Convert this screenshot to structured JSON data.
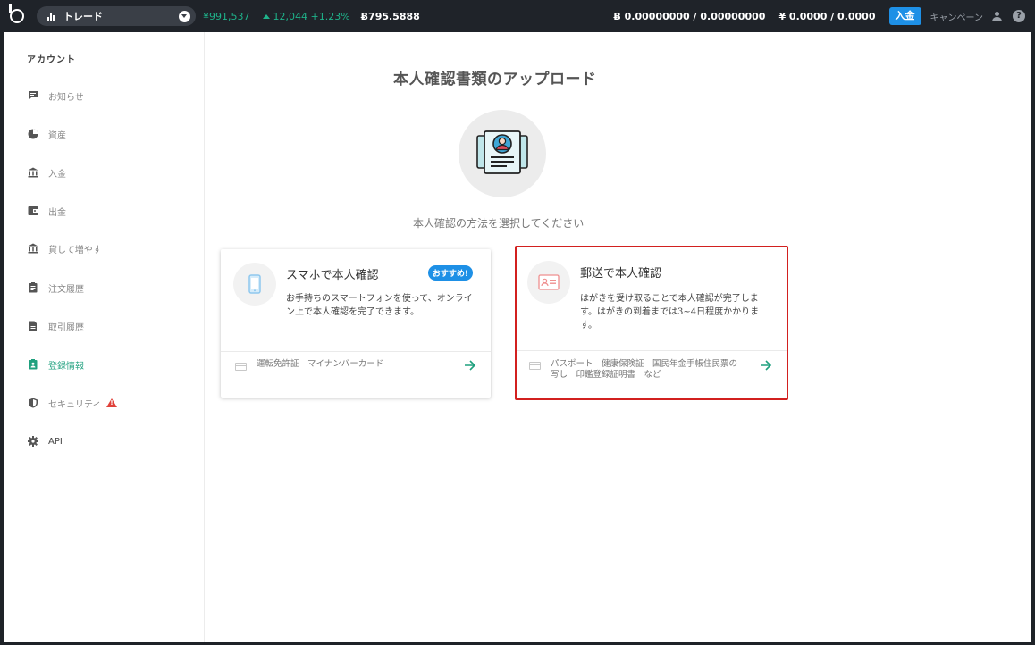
{
  "topbar": {
    "trade_label": "トレード",
    "price_jpy": "¥991,537",
    "change": "12,044 +1.23%",
    "btc_amount": "Ƀ795.5888",
    "btc_balance": "Ƀ 0.00000000 / 0.00000000",
    "jpy_balance": "¥ 0.0000 / 0.0000",
    "deposit_label": "入金",
    "campaign_label": "キャンペーン",
    "help_label": "?",
    "colors": {
      "bg": "#1f2329",
      "green": "#1fb28a",
      "accent": "#1e90e6"
    }
  },
  "sidebar": {
    "title": "アカウント",
    "items": [
      {
        "label": "お知らせ",
        "icon": "message-icon",
        "active": false
      },
      {
        "label": "資産",
        "icon": "pie-chart-icon",
        "active": false
      },
      {
        "label": "入金",
        "icon": "bank-icon",
        "active": false
      },
      {
        "label": "出金",
        "icon": "wallet-icon",
        "active": false
      },
      {
        "label": "貸して増やす",
        "icon": "bank-icon",
        "active": false
      },
      {
        "label": "注文履歴",
        "icon": "clipboard-icon",
        "active": false
      },
      {
        "label": "取引履歴",
        "icon": "document-icon",
        "active": false
      },
      {
        "label": "登録情報",
        "icon": "id-badge-icon",
        "active": true
      },
      {
        "label": "セキュリティ",
        "icon": "shield-icon",
        "active": false,
        "warning": true
      },
      {
        "label": "API",
        "icon": "gear-icon",
        "active": false
      }
    ]
  },
  "main": {
    "title": "本人確認書類のアップロード",
    "subtitle": "本人確認の方法を選択してください",
    "cards": [
      {
        "title": "スマホで本人確認",
        "badge": "おすすめ!",
        "description": "お手持ちのスマートフォンを使って、オンライン上で本人確認を完了できます。",
        "documents": "運転免許証　マイナンバーカード",
        "icon": "smartphone-icon"
      },
      {
        "title": "郵送で本人確認",
        "description": "はがきを受け取ることで本人確認が完了します。はがきの到着までは3~4日程度かかります。",
        "documents": "パスポート　健康保険証　国民年金手帳住民票の写し　印鑑登録証明書　など",
        "icon": "id-card-icon"
      }
    ]
  }
}
